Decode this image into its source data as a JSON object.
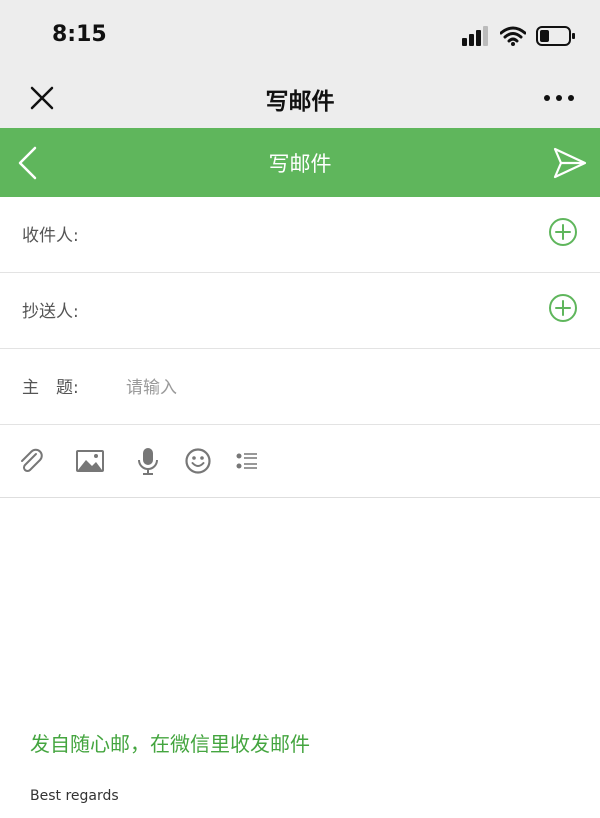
{
  "status_bar": {
    "time": "8:15"
  },
  "nav": {
    "title": "写邮件"
  },
  "header": {
    "title": "写邮件"
  },
  "fields": {
    "to_label": "收件人:",
    "cc_label": "抄送人:",
    "subject_label": "主　题:",
    "subject_placeholder": "请输入"
  },
  "body": {
    "signature": "发自随心邮，在微信里收发邮件",
    "regards": "Best regards"
  },
  "colors": {
    "accent": "#5fb65c",
    "text_green": "#44a53f"
  },
  "icons": [
    "close-icon",
    "more-icon",
    "back-icon",
    "send-icon",
    "add-circle-icon",
    "attachment-icon",
    "image-icon",
    "microphone-icon",
    "emoji-icon",
    "list-icon"
  ]
}
